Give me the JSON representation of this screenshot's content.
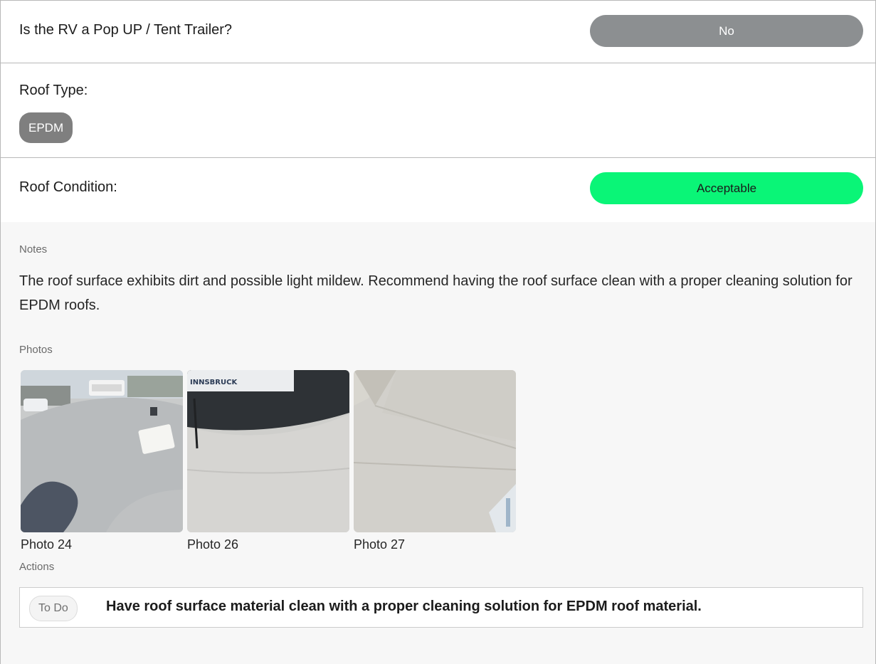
{
  "questions": {
    "popup": {
      "label": "Is the RV a Pop UP / Tent Trailer?",
      "answer": "No",
      "answer_color": "#8c8f91"
    },
    "roof_type": {
      "label": "Roof Type:",
      "value": "EPDM"
    },
    "roof_condition": {
      "label": "Roof Condition:",
      "answer": "Acceptable",
      "answer_color": "#0af577"
    }
  },
  "details": {
    "notes_label": "Notes",
    "notes_text": "The roof surface exhibits dirt and possible light mildew. Recommend having the roof surface clean with a proper cleaning solution for EPDM roofs.",
    "photos_label": "Photos",
    "photos": [
      {
        "caption": "Photo 24"
      },
      {
        "caption": "Photo 26"
      },
      {
        "caption": "Photo 27"
      }
    ],
    "actions_label": "Actions",
    "actions": [
      {
        "status": "To Do",
        "text": "Have roof surface material clean with a proper cleaning solution for EPDM roof material."
      }
    ]
  }
}
